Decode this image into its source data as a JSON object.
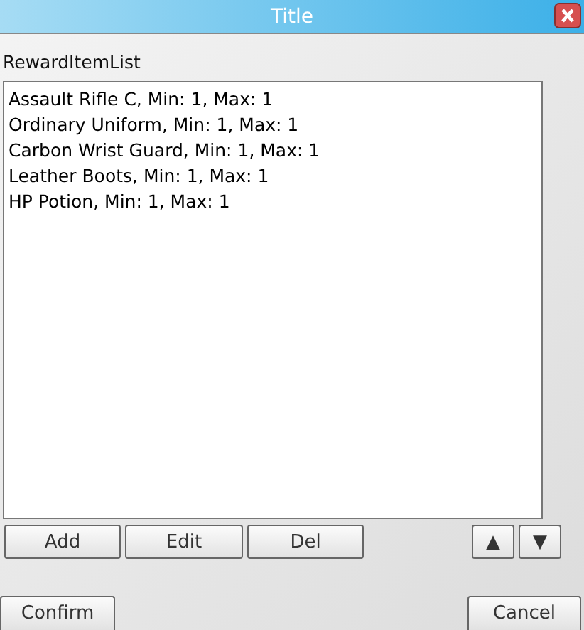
{
  "window": {
    "title": "Title"
  },
  "list": {
    "label": "RewardItemList",
    "items": [
      {
        "text": "Assault Rifle C, Min: 1, Max: 1"
      },
      {
        "text": "Ordinary Uniform, Min: 1, Max: 1"
      },
      {
        "text": "Carbon Wrist Guard, Min: 1, Max: 1"
      },
      {
        "text": "Leather Boots, Min: 1, Max: 1"
      },
      {
        "text": "HP Potion, Min: 1, Max: 1"
      }
    ]
  },
  "list_buttons": [
    "Add",
    "Edit",
    "Del"
  ],
  "move_buttons": [
    "▲",
    "▼"
  ],
  "footer_buttons": [
    "Confirm",
    "Cancel"
  ]
}
